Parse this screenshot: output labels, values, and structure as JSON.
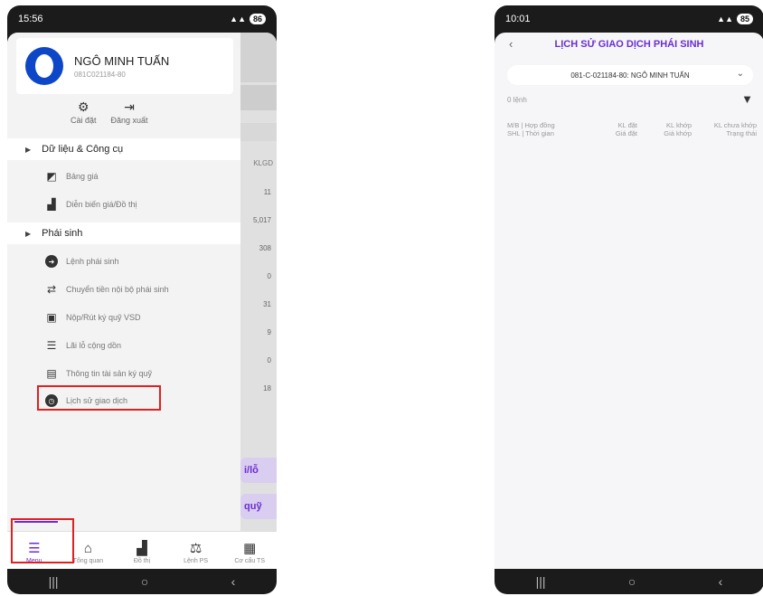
{
  "left_phone": {
    "status": {
      "time": "15:56",
      "battery": "86"
    },
    "profile": {
      "name": "NGÔ MINH TUẤN",
      "account": "081C021184-80"
    },
    "quick_actions": [
      {
        "label": "Cài đặt",
        "icon": "gear-icon"
      },
      {
        "label": "Đăng xuất",
        "icon": "logout-icon"
      }
    ],
    "sections": {
      "tools": "Dữ liệu & Công cụ",
      "derivatives": "Phái sinh"
    },
    "tools_items": [
      {
        "label": "Bảng giá",
        "icon": "price-board-icon"
      },
      {
        "label": "Diễn biến giá/Đồ thị",
        "icon": "bar-chart-icon"
      }
    ],
    "derivative_items": [
      {
        "label": "Lệnh phái sinh",
        "icon": "arrow-circle-icon"
      },
      {
        "label": "Chuyển tiền nội bộ phái sinh",
        "icon": "transfer-icon"
      },
      {
        "label": "Nộp/Rút ký quỹ VSD",
        "icon": "deposit-icon"
      },
      {
        "label": "Lãi lỗ cộng dồn",
        "icon": "profit-loss-icon"
      },
      {
        "label": "Thông tin tài sản ký quỹ",
        "icon": "document-icon"
      },
      {
        "label": "Lịch sử giao dịch",
        "icon": "clock-icon"
      }
    ],
    "underlay": {
      "column_header": "KLGD",
      "values": [
        "11",
        "5,017",
        "308",
        "0",
        "31",
        "9",
        "0",
        "18"
      ],
      "buttons": [
        "i/lỗ",
        "quỹ"
      ]
    },
    "tabs": [
      {
        "label": "Menu",
        "icon": "hamburger-icon"
      },
      {
        "label": "Tổng quan",
        "icon": "home-icon"
      },
      {
        "label": "Đồ thị",
        "icon": "chart-icon"
      },
      {
        "label": "Lệnh PS",
        "icon": "order-icon"
      },
      {
        "label": "Cơ cấu TS",
        "icon": "portfolio-icon"
      }
    ]
  },
  "right_phone": {
    "status": {
      "time": "10:01",
      "battery": "85"
    },
    "title": "LỊCH SỬ GIAO DỊCH PHÁI SINH",
    "account_select": "081-C-021184-80: NGÔ MINH TUẤN",
    "order_count": "0 lệnh",
    "columns": [
      {
        "line1": "M/B | Hợp đồng",
        "line2": "SHL | Thời gian"
      },
      {
        "line1": "KL đặt",
        "line2": "Giá đặt"
      },
      {
        "line1": "KL khớp",
        "line2": "Giá khớp"
      },
      {
        "line1": "KL chưa khớp",
        "line2": "Trạng thái"
      }
    ]
  },
  "colors": {
    "accent": "#6a2fd0",
    "highlight": "#e02020",
    "avatar": "#0d47c7"
  }
}
